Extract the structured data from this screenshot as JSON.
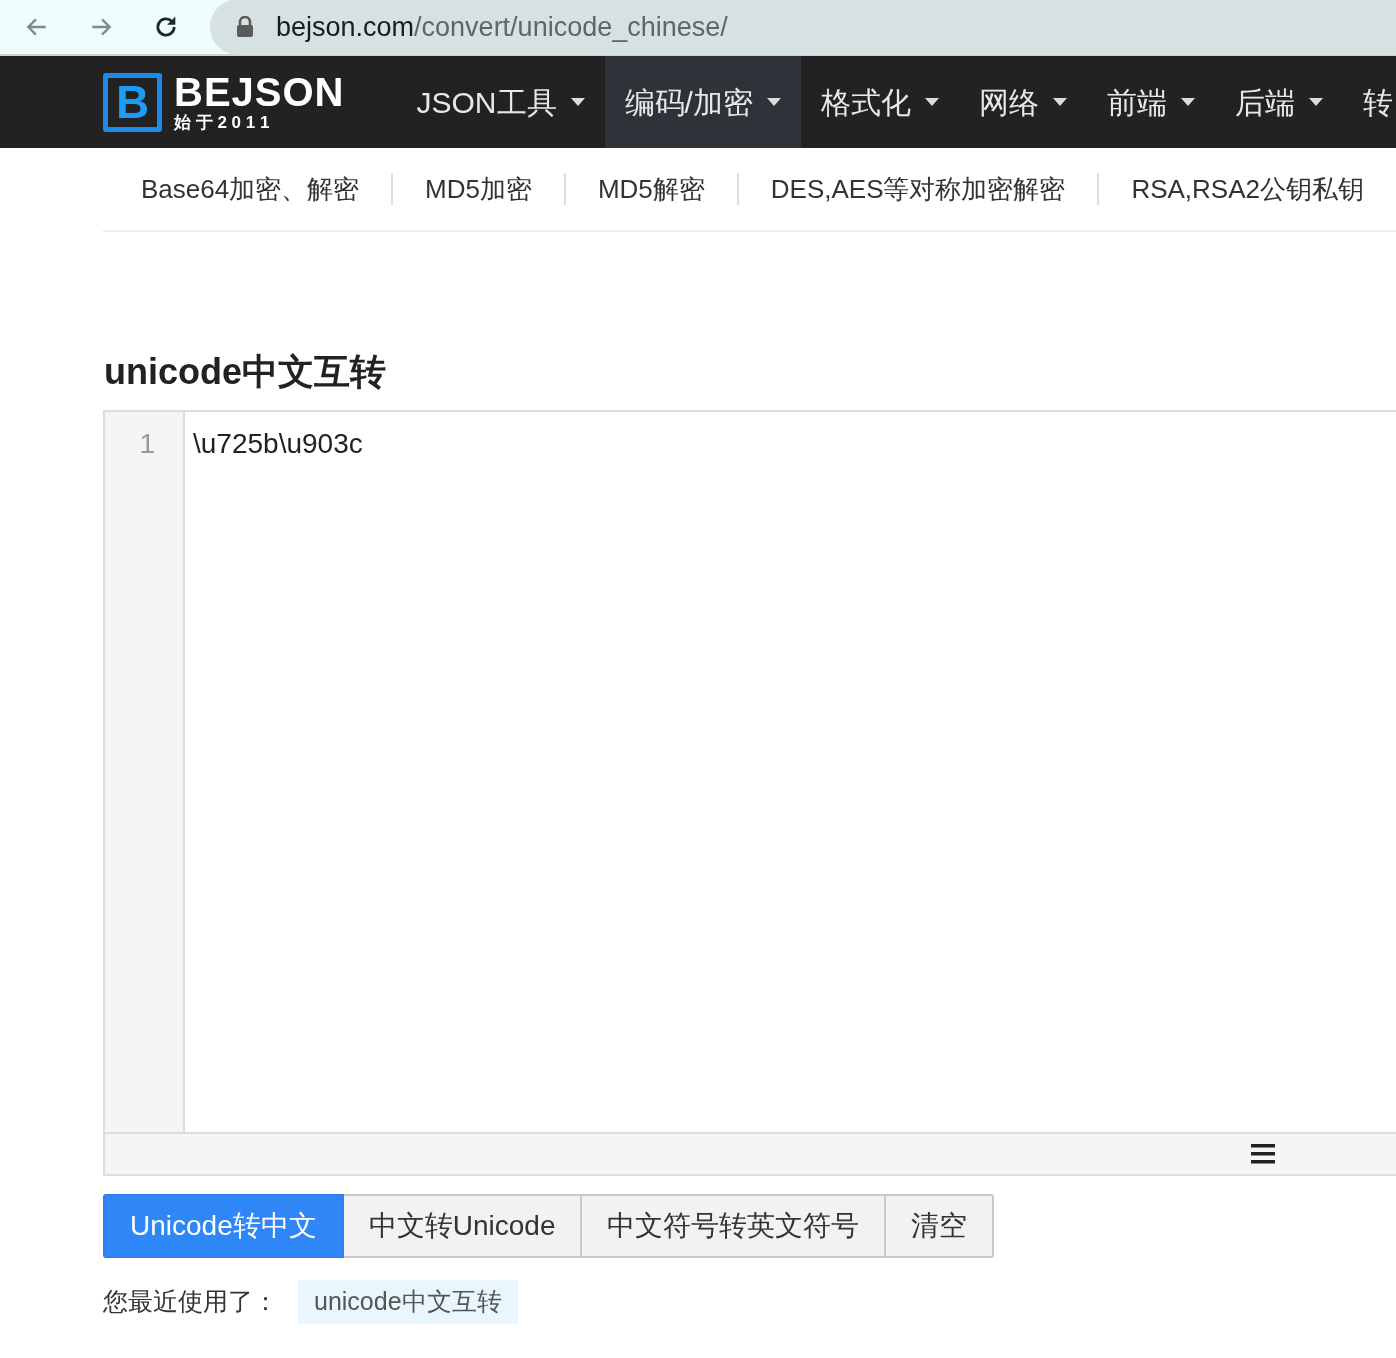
{
  "browser": {
    "url_host": "bejson.com",
    "url_path": "/convert/unicode_chinese/"
  },
  "logo": {
    "mark": "B",
    "name": "BEJSON",
    "tagline": "始 于 2 0 1 1"
  },
  "nav": [
    {
      "label": "JSON工具",
      "selected": false,
      "caret": true
    },
    {
      "label": "编码/加密",
      "selected": true,
      "caret": true
    },
    {
      "label": "格式化",
      "selected": false,
      "caret": true
    },
    {
      "label": "网络",
      "selected": false,
      "caret": true
    },
    {
      "label": "前端",
      "selected": false,
      "caret": true
    },
    {
      "label": "后端",
      "selected": false,
      "caret": true
    },
    {
      "label": "转",
      "selected": false,
      "caret": false
    }
  ],
  "subnav": [
    "Base64加密、解密",
    "MD5加密",
    "MD5解密",
    "DES,AES等对称加密解密",
    "RSA,RSA2公钥私钥"
  ],
  "title": "unicode中文互转",
  "editor": {
    "lines": [
      {
        "number": "1",
        "text": "\\u725b\\u903c"
      }
    ]
  },
  "buttons": [
    {
      "label": "Unicode转中文",
      "selected": true
    },
    {
      "label": "中文转Unicode",
      "selected": false
    },
    {
      "label": "中文符号转英文符号",
      "selected": false
    },
    {
      "label": "清空",
      "selected": false
    }
  ],
  "recent": {
    "label": "您最近使用了：",
    "items": [
      "unicode中文互转"
    ]
  }
}
